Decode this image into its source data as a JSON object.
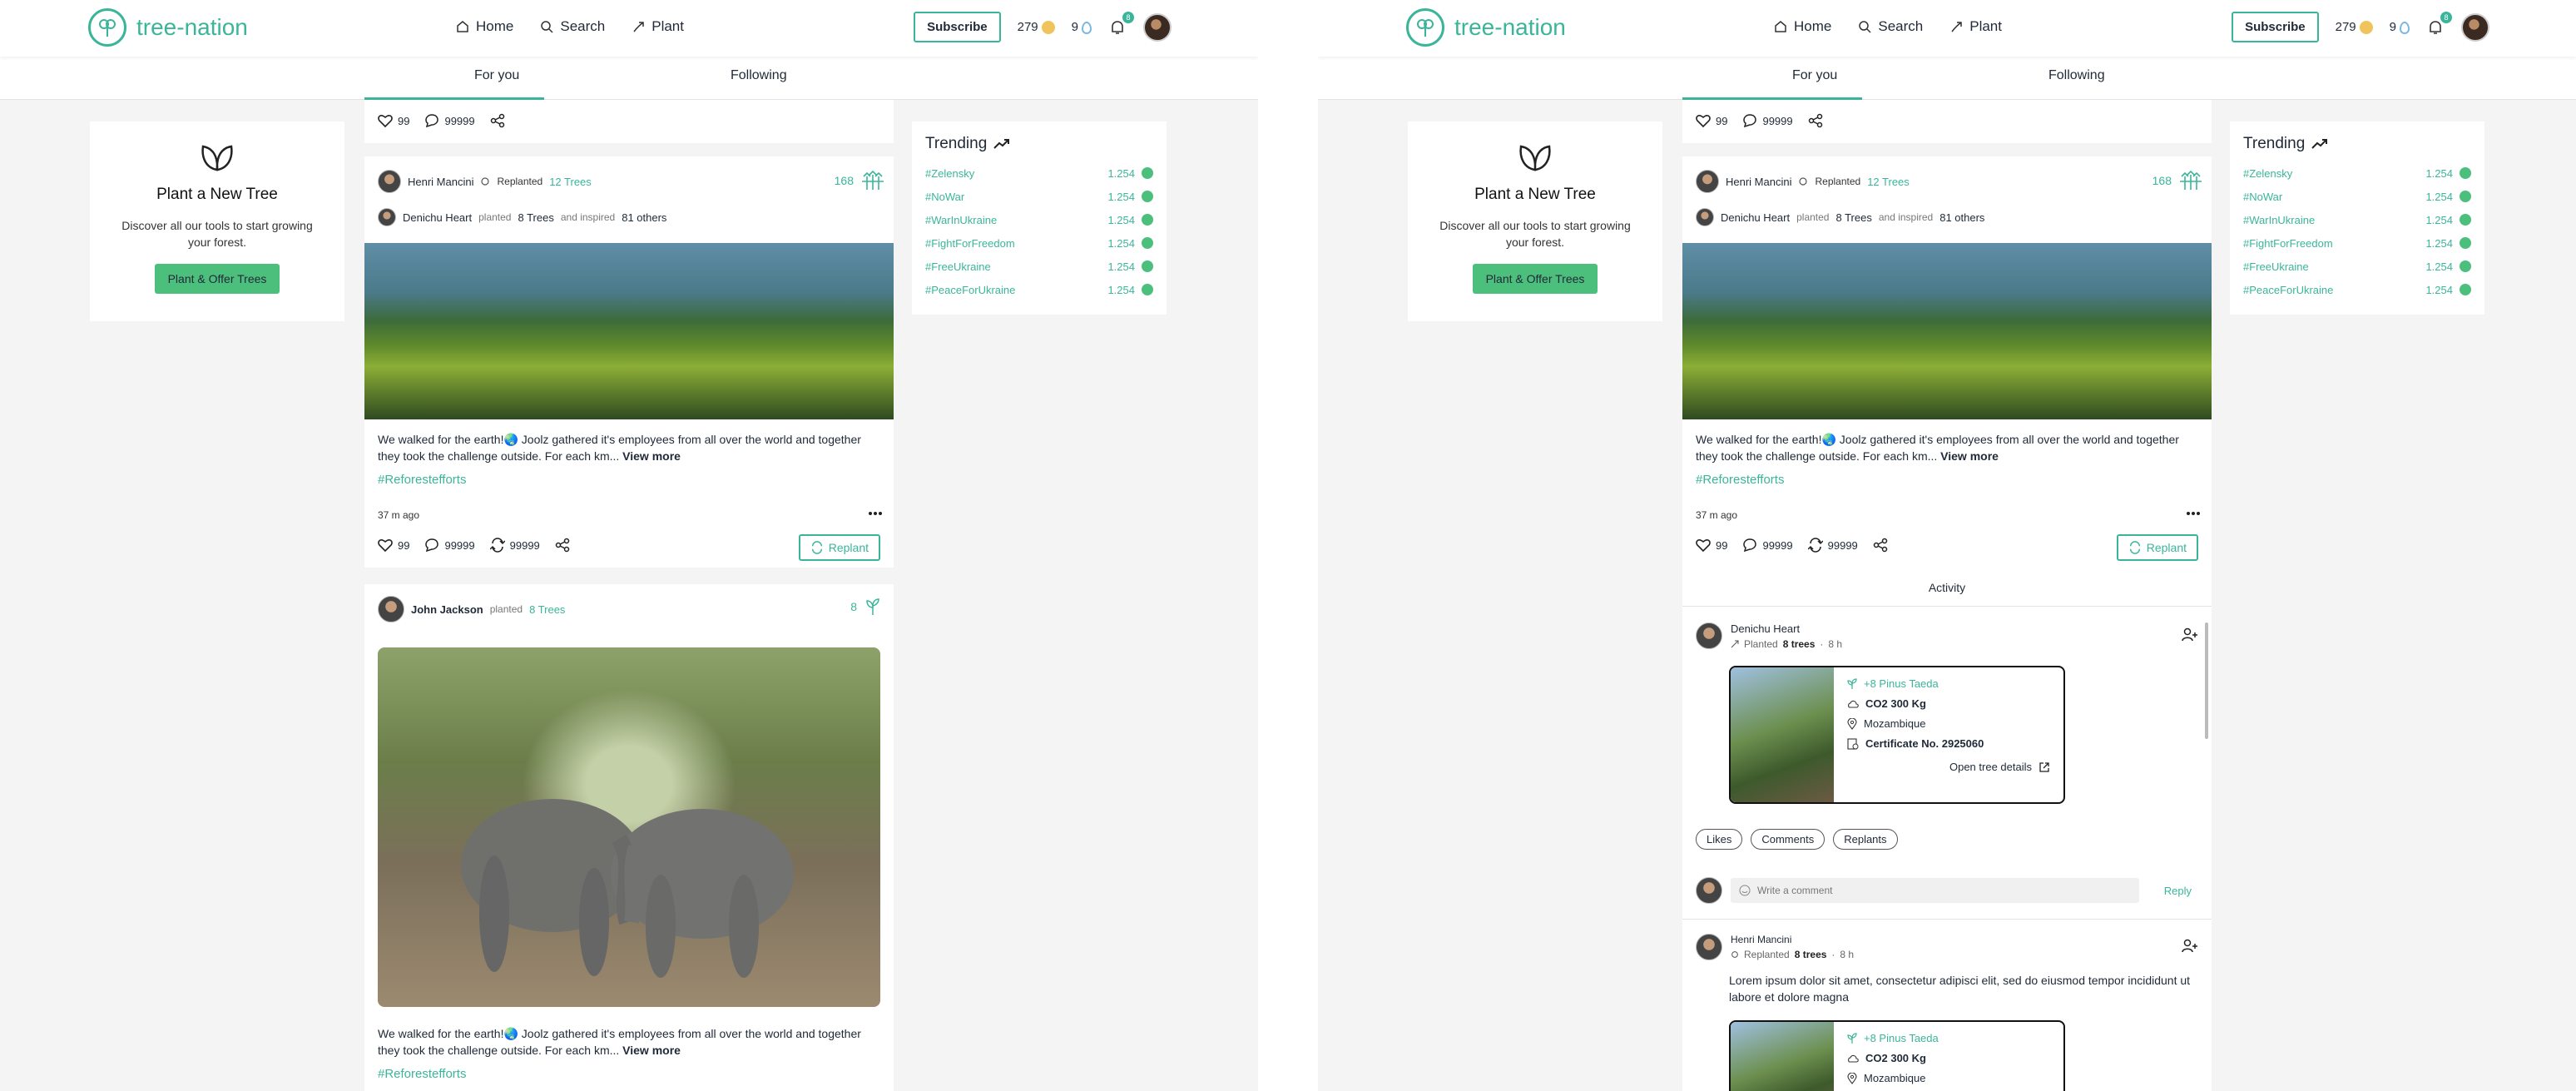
{
  "brand": {
    "name": "tree-nation",
    "accent": "#3bb59a"
  },
  "nav": {
    "home": "Home",
    "search": "Search",
    "plant": "Plant"
  },
  "header": {
    "subscribe": "Subscribe",
    "coins": "279",
    "drops": "9",
    "notif_count": "8"
  },
  "tabs": {
    "for_you": "For you",
    "following": "Following"
  },
  "plant_card": {
    "title": "Plant a New Tree",
    "desc": "Discover all our tools to start growing your forest.",
    "button": "Plant & Offer Trees"
  },
  "trending": {
    "title": "Trending",
    "items": [
      {
        "tag": "#Zelensky",
        "count": "1.254"
      },
      {
        "tag": "#NoWar",
        "count": "1.254"
      },
      {
        "tag": "#WarInUkraine",
        "count": "1.254"
      },
      {
        "tag": "#FightForFreedom",
        "count": "1.254"
      },
      {
        "tag": "#FreeUkraine",
        "count": "1.254"
      },
      {
        "tag": "#PeaceForUkraine",
        "count": "1.254"
      }
    ]
  },
  "top_actions": {
    "likes": "99",
    "comments": "99999"
  },
  "post1": {
    "user": "Henri Mancini",
    "replanted": "Replanted",
    "trees_link": "12 Trees",
    "count": "168",
    "sub_user": "Denichu Heart",
    "planted": "planted",
    "sub_trees": "8 Trees",
    "and_inspired": "and inspired",
    "others": "81 others",
    "text": "We walked for the earth!🌏 Joolz gathered it's employees from all over the world and together they took the challenge outside. For each km...",
    "view_more": "View more",
    "hashtag": "#Reforestefforts",
    "time": "37 m ago",
    "likes": "99",
    "comments": "99999",
    "replants": "99999",
    "replant_btn": "Replant"
  },
  "post2": {
    "user": "John Jackson",
    "planted": "planted",
    "trees_link": "8 Trees",
    "count": "8",
    "text": "We walked for the earth!🌏 Joolz gathered it's employees from all over the world and together they took the challenge outside. For each km...",
    "view_more": "View more",
    "hashtag": "#Reforestefforts"
  },
  "activity": {
    "title": "Activity",
    "entry1": {
      "user": "Denichu Heart",
      "action": "Planted",
      "trees": "8 trees",
      "sep": "·",
      "time": "8 h",
      "species": "+8 Pinus Taeda",
      "co2": "CO2 300 Kg",
      "location": "Mozambique",
      "certificate": "Certificate No. 2925060",
      "open": "Open tree details"
    },
    "pills": {
      "likes": "Likes",
      "comments": "Comments",
      "replants": "Replants"
    },
    "comment_placeholder": "Write a comment",
    "reply": "Reply",
    "entry2": {
      "user": "Henri Mancini",
      "action": "Replanted",
      "trees": "8 trees",
      "sep": "·",
      "time": "8 h",
      "text": "Lorem ipsum dolor sit amet, consectetur adipisci elit, sed do eiusmod tempor incididunt ut labore et dolore magna",
      "species": "+8 Pinus Taeda",
      "co2": "CO2 300 Kg",
      "location": "Mozambique"
    }
  }
}
